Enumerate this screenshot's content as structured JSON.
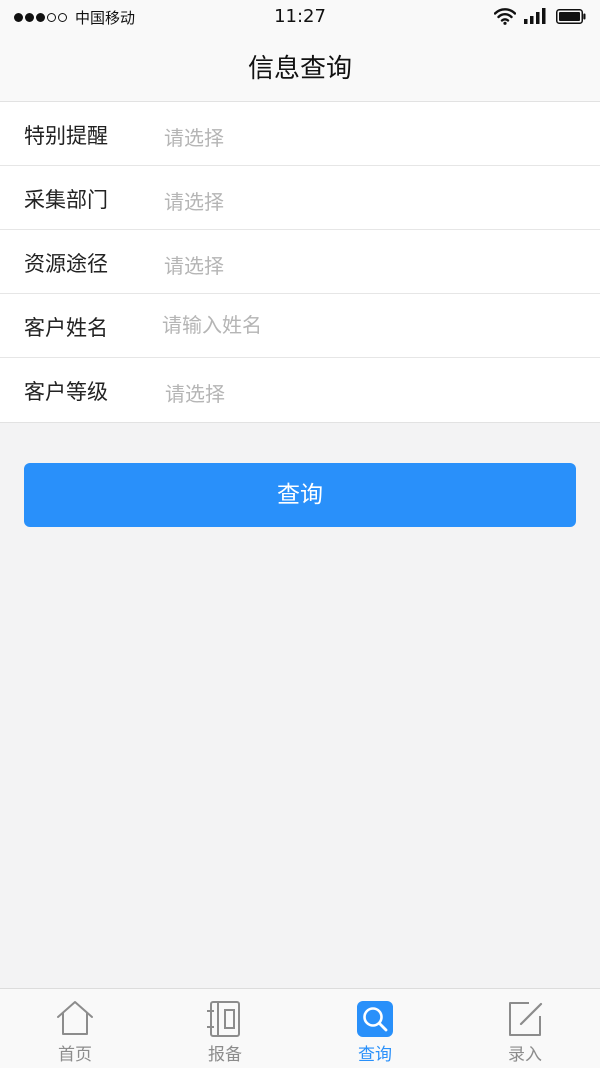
{
  "status_bar": {
    "carrier": "中国移动",
    "time": "11:27"
  },
  "nav": {
    "title": "信息查询"
  },
  "form": {
    "rows": [
      {
        "label": "特别提醒",
        "value": "请选择"
      },
      {
        "label": "采集部门",
        "value": "请选择"
      },
      {
        "label": "资源途径",
        "value": "请选择"
      },
      {
        "label": "客户姓名",
        "placeholder": "请输入姓名"
      },
      {
        "label": "客户等级",
        "value": "请选择"
      }
    ]
  },
  "query_button": {
    "label": "查询"
  },
  "tab_bar": {
    "tabs": [
      {
        "label": "首页",
        "icon": "home-icon"
      },
      {
        "label": "报备",
        "icon": "notebook-icon"
      },
      {
        "label": "查询",
        "icon": "search-icon",
        "active": true
      },
      {
        "label": "录入",
        "icon": "edit-icon"
      }
    ]
  },
  "colors": {
    "accent": "#2990fa",
    "inactive_tab": "#8c8c8c",
    "placeholder": "#b5b5b5"
  }
}
